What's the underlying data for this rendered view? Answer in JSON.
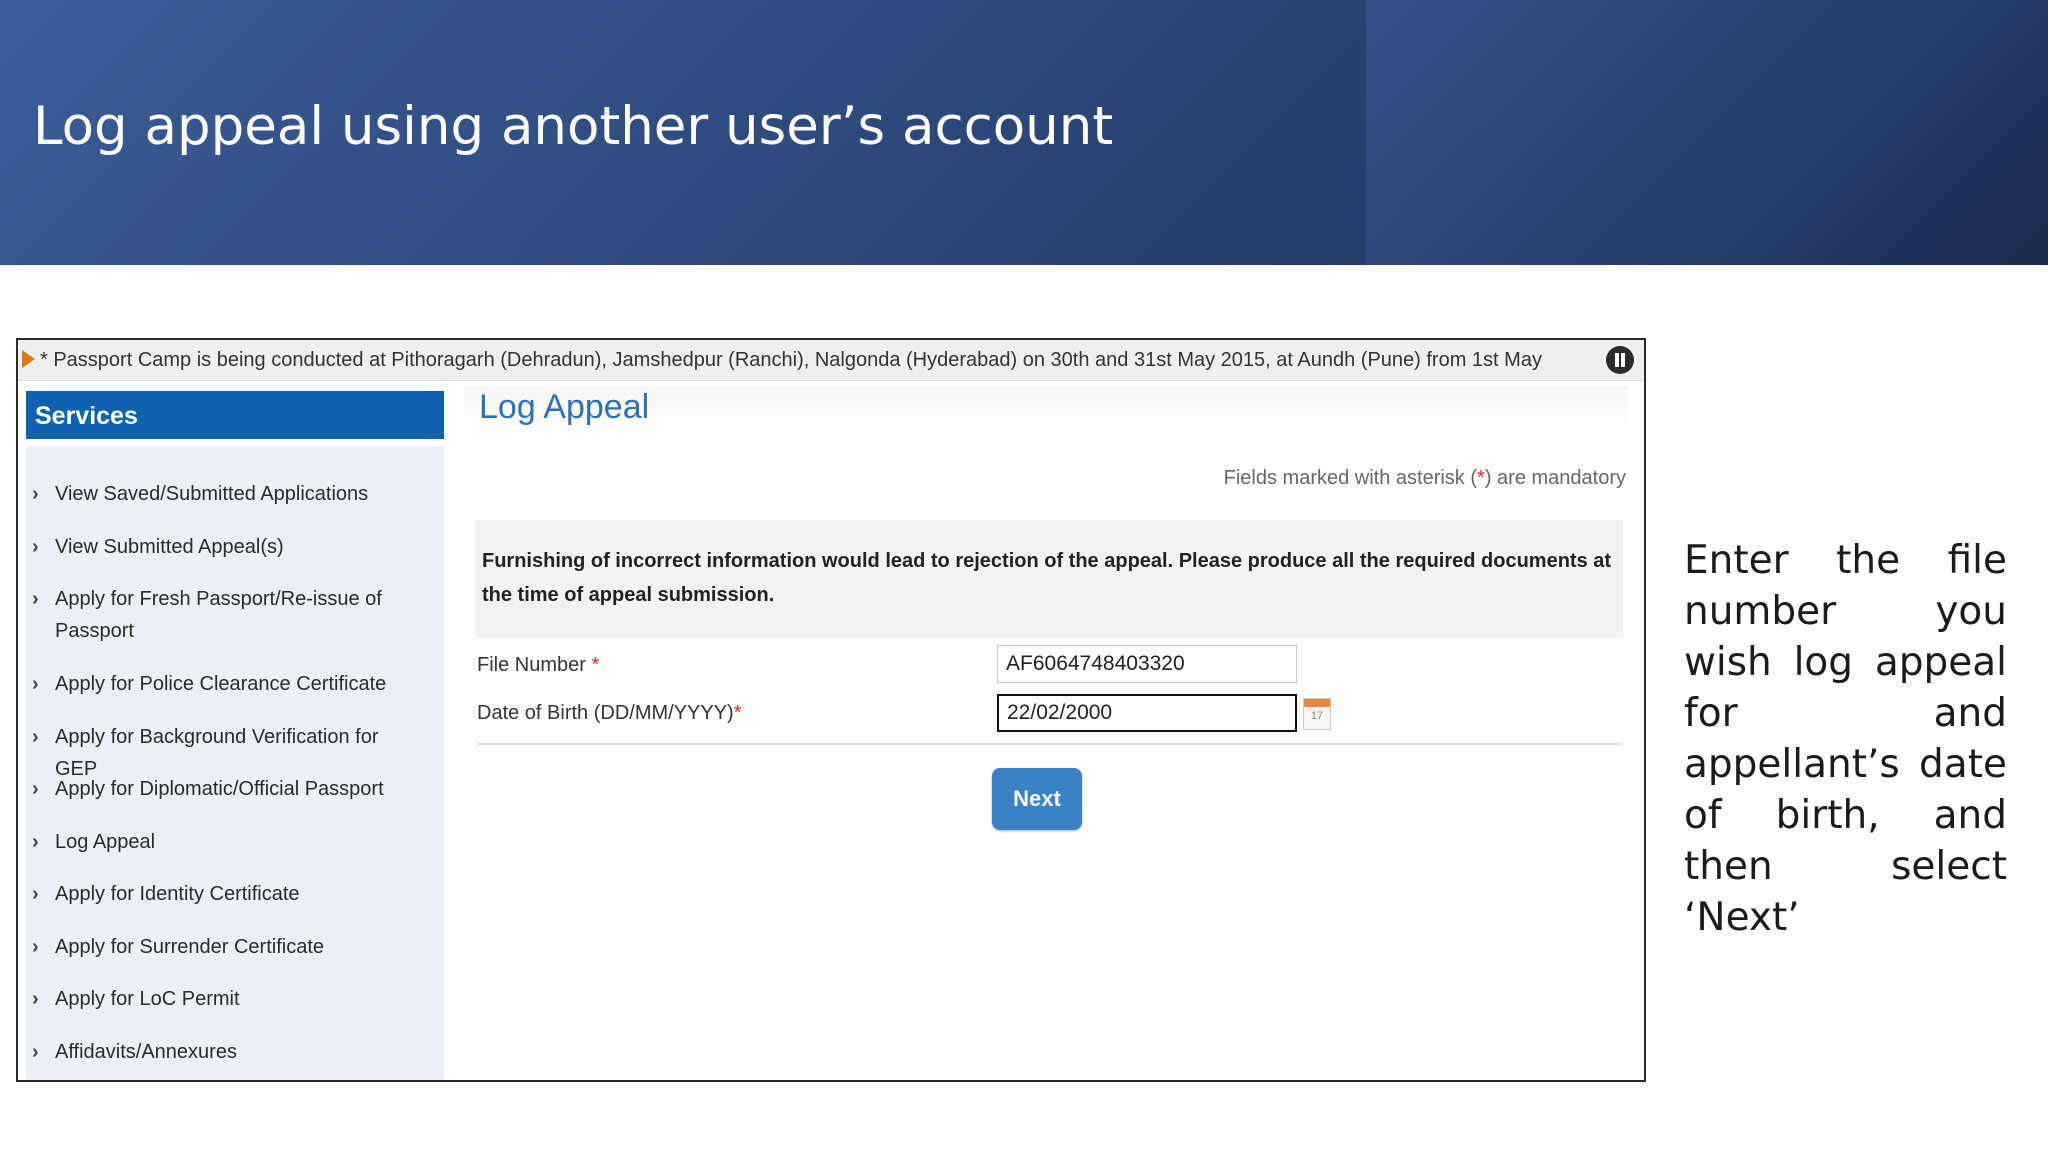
{
  "slide": {
    "title": "Log appeal using another user’s account",
    "caption": "Enter the file number you wish log appeal for and appellant’s date of birth, and then select ‘Next’"
  },
  "ticker": {
    "text": "* Passport Camp is being conducted at Pithoragarh (Dehradun), Jamshedpur (Ranchi), Nalgonda (Hyderabad) on 30th and 31st May 2015, at Aundh (Pune) from 1st May",
    "pause_icon": "pause-icon"
  },
  "sidebar": {
    "heading": "Services",
    "items": [
      {
        "label": "View Saved/Submitted Applications"
      },
      {
        "label": "View Submitted Appeal(s)"
      },
      {
        "label": "Apply for Fresh Passport/Re-issue of Passport"
      },
      {
        "label": "Apply for Police Clearance Certificate"
      },
      {
        "label": "Apply for Background Verification for GEP"
      },
      {
        "label": "Apply for Diplomatic/Official Passport"
      },
      {
        "label": "Log Appeal"
      },
      {
        "label": "Apply for Identity Certificate"
      },
      {
        "label": "Apply for Surrender Certificate"
      },
      {
        "label": "Apply for LoC Permit"
      },
      {
        "label": "Affidavits/Annexures"
      }
    ]
  },
  "main": {
    "title": "Log Appeal",
    "mandatory_note_pre": "Fields marked with asterisk (",
    "mandatory_star": "*",
    "mandatory_note_post": ") are mandatory",
    "warning": "Furnishing of incorrect information would lead to rejection of the appeal. Please produce all the required documents at the time of appeal submission.",
    "file_number": {
      "label": "File Number",
      "required": "*",
      "value": "AF6064748403320"
    },
    "dob": {
      "label": "Date of Birth (DD/MM/YYYY)",
      "required": "*",
      "value": "22/02/2000"
    },
    "calendar_day": "17",
    "next_label": "Next"
  },
  "colors": {
    "banner": "#2b4678",
    "services_header": "#0f62b0",
    "title_blue": "#2f6fb6",
    "next_button": "#3b82c4",
    "required_red": "#d62d20"
  }
}
